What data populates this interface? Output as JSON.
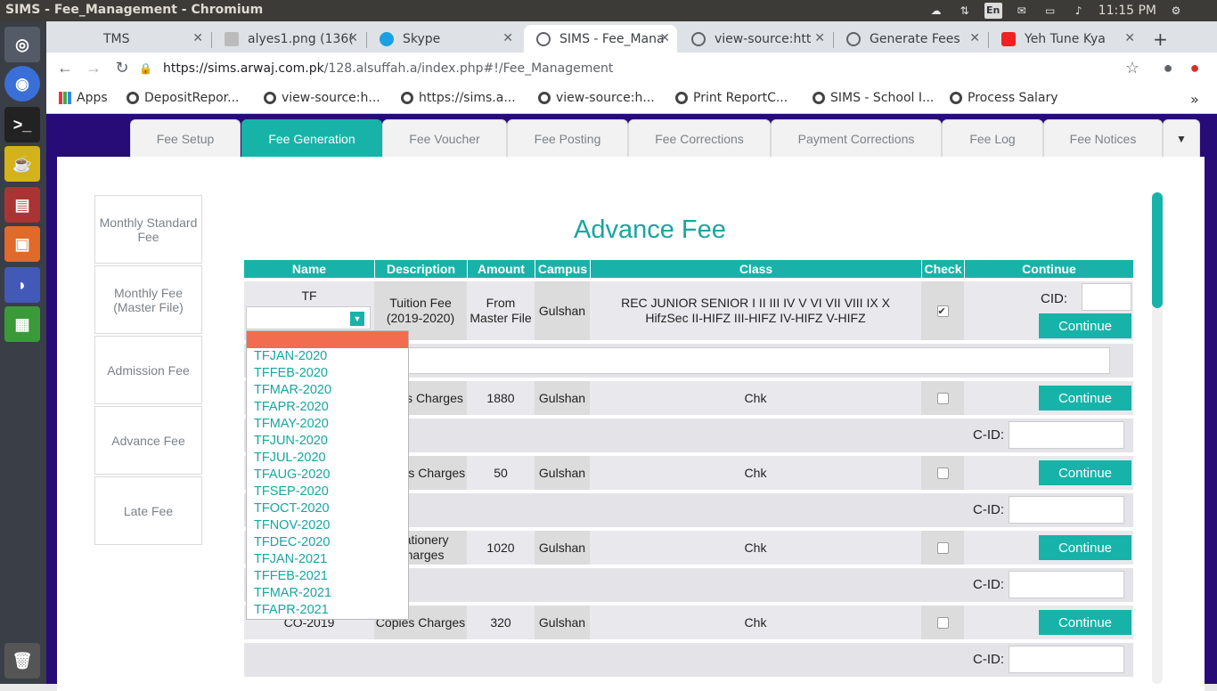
{
  "os": {
    "window_title": "SIMS - Fee_Management - Chromium",
    "tray": {
      "lang": "En",
      "clock": "11:15 PM"
    }
  },
  "browser": {
    "tabs": [
      {
        "label": "TMS"
      },
      {
        "label": "alyes1.png (136("
      },
      {
        "label": "Skype"
      },
      {
        "label": "SIMS - Fee_Mana"
      },
      {
        "label": "view-source:htt"
      },
      {
        "label": "Generate Fees"
      },
      {
        "label": "Yeh Tune Kya"
      }
    ],
    "url_host": "https://sims.arwaj.com.pk",
    "url_path": "/128.alsuffah.a/index.php#!/Fee_Management",
    "bookmarks": [
      {
        "label": "Apps"
      },
      {
        "label": "DepositRepor..."
      },
      {
        "label": "view-source:h..."
      },
      {
        "label": "https://sims.a..."
      },
      {
        "label": "view-source:h..."
      },
      {
        "label": "Print ReportC..."
      },
      {
        "label": "SIMS - School I..."
      },
      {
        "label": "Process Salary"
      }
    ],
    "more_bookmarks": "»"
  },
  "module_tabs": [
    {
      "label": "Fee Setup"
    },
    {
      "label": "Fee Generation"
    },
    {
      "label": "Fee Voucher"
    },
    {
      "label": "Fee Posting"
    },
    {
      "label": "Fee Corrections"
    },
    {
      "label": "Payment Corrections"
    },
    {
      "label": "Fee Log"
    },
    {
      "label": "Fee Notices"
    }
  ],
  "sidebar": [
    {
      "label": "Monthly Standard Fee"
    },
    {
      "label": "Monthly Fee (Master File)"
    },
    {
      "label": "Admission Fee"
    },
    {
      "label": "Advance Fee"
    },
    {
      "label": "Late Fee"
    }
  ],
  "heading": "Advance Fee",
  "table": {
    "columns": [
      "Name",
      "Description",
      "Amount",
      "Campus",
      "Class",
      "Check",
      "Continue"
    ],
    "rows": [
      {
        "name": "TF",
        "description": "Tuition Fee (2019-2020)",
        "amount": "From Master File",
        "campus": "Gulshan",
        "class": "REC JUNIOR SENIOR I II III IV V VI VII VIII IX X HifzSec II-HIFZ III-HIFZ IV-HIFZ V-HIFZ",
        "checked": true,
        "cid_label": "CID:",
        "continue": "Continue"
      },
      {
        "name": "",
        "description": "Books Charges",
        "amount": "1880",
        "campus": "Gulshan",
        "class": "Chk",
        "checked": false,
        "cid_label": "C-ID:",
        "continue": "Continue"
      },
      {
        "name": "",
        "description": "Copies Charges",
        "amount": "50",
        "campus": "Gulshan",
        "class": "Chk",
        "checked": false,
        "cid_label": "C-ID:",
        "continue": "Continue"
      },
      {
        "name": "",
        "description": "Stationery Charges",
        "amount": "1020",
        "campus": "Gulshan",
        "class": "Chk",
        "checked": false,
        "cid_label": "C-ID:",
        "continue": "Continue"
      },
      {
        "name": "CO-2019",
        "description": "Copies Charges",
        "amount": "320",
        "campus": "Gulshan",
        "class": "Chk",
        "checked": false,
        "cid_label": "C-ID:",
        "continue": "Continue"
      }
    ]
  },
  "dropdown": {
    "options": [
      "TFJAN-2020",
      "TFFEB-2020",
      "TFMAR-2020",
      "TFAPR-2020",
      "TFMAY-2020",
      "TFJUN-2020",
      "TFJUL-2020",
      "TFAUG-2020",
      "TFSEP-2020",
      "TFOCT-2020",
      "TFNOV-2020",
      "TFDEC-2020",
      "TFJAN-2021",
      "TFFEB-2021",
      "TFMAR-2021",
      "TFAPR-2021"
    ]
  },
  "colors": {
    "accent": "#17b3a9",
    "highlight": "#f26c4f",
    "page_bg": "#270c78"
  }
}
